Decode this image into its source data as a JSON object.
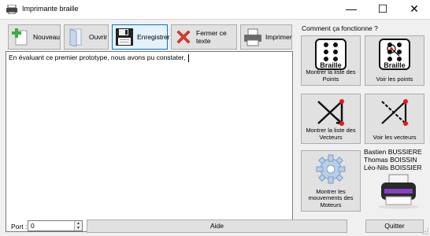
{
  "window": {
    "title": "Imprimante braille",
    "minimize": "—",
    "maximize": "☐",
    "close": "✕"
  },
  "toolbar": {
    "new_label": "Nouveau",
    "open_label": "Ouvrir",
    "save_label": "Enregistrer",
    "close_text_label": "Fermer ce texte",
    "print_label": "Imprimer"
  },
  "editor": {
    "text": "En évaluant ce premier prototype, nous avons pu constater, "
  },
  "help_panel": {
    "title": "Comment ça fonctionne ?",
    "braille_word": "Braille",
    "show_points_list": "Montrer la liste des Points",
    "view_points": "Voir les points",
    "show_vectors_list": "Montrer la liste des Vecteurs",
    "view_vectors": "Voir les vecteurs",
    "show_motor_moves": "Montrer les mouvements des Moteurs"
  },
  "credits": [
    "Bastien BUSSIERE",
    "Thomas BOISSIN",
    "Léo-Nils BOISSIER"
  ],
  "bottom": {
    "port_label": "Port :",
    "port_value": "0",
    "help_button": "Aide",
    "quit_button": "Quitter"
  },
  "icons": {
    "new": "plus-document-icon",
    "open": "open-folder-icon",
    "save": "floppy-disk-icon",
    "close_text": "red-x-icon",
    "print": "printer-icon",
    "points": "braille-cell-icon",
    "vectors": "vector-arrows-icon",
    "motors": "gear-icon",
    "logo": "braille-printer-icon"
  },
  "colors": {
    "accent": "#0078d7",
    "red_point": "#e11a1a",
    "printer_purple": "#8a3fc7"
  }
}
